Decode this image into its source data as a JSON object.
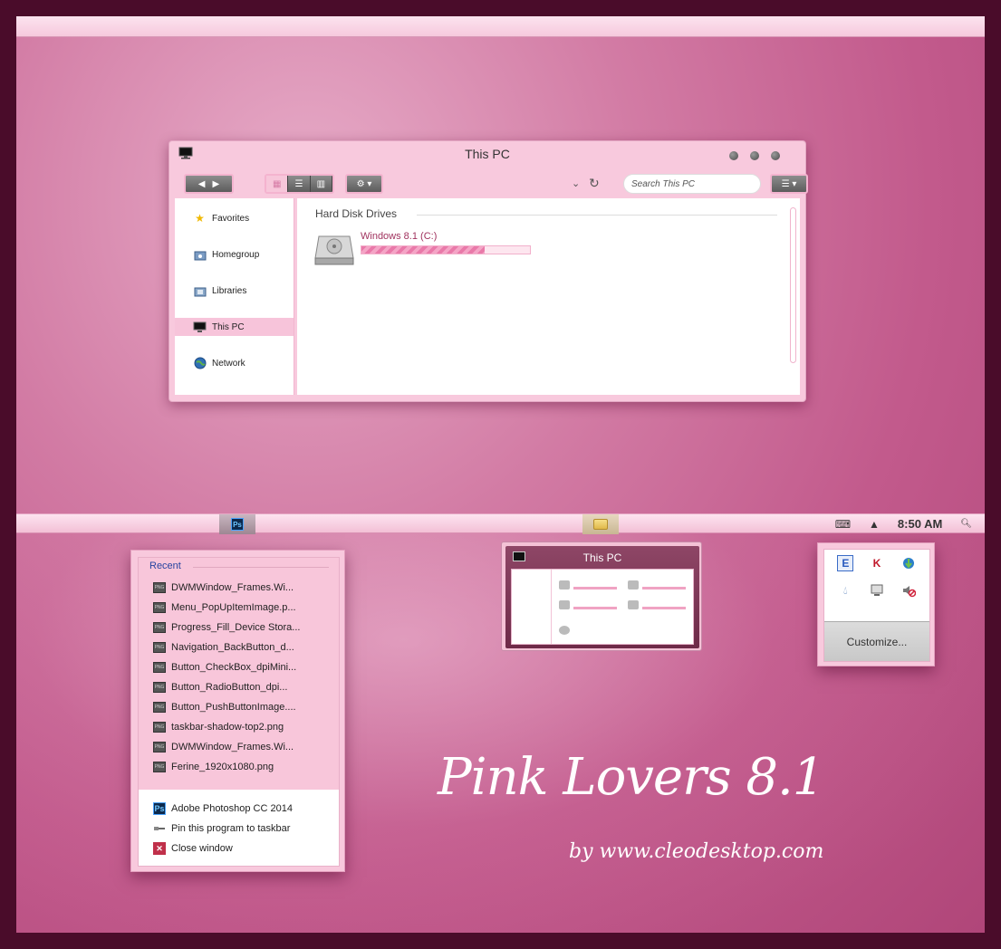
{
  "explorer": {
    "title": "This PC",
    "search_placeholder": "Search This PC",
    "nav_items": [
      {
        "label": "Favorites",
        "icon": "star-icon"
      },
      {
        "label": "Homegroup",
        "icon": "homegroup-icon"
      },
      {
        "label": "Libraries",
        "icon": "libraries-icon"
      },
      {
        "label": "This PC",
        "icon": "computer-icon",
        "selected": true
      },
      {
        "label": "Network",
        "icon": "globe-icon"
      }
    ],
    "section_header": "Hard Disk Drives",
    "drive": {
      "label": "Windows 8.1 (C:)",
      "used_fraction": 0.73
    }
  },
  "taskbar": {
    "clock": "8:50 AM",
    "apps": [
      "photoshop-icon",
      "file-explorer-icon"
    ]
  },
  "jumplist": {
    "recent_header": "Recent",
    "recent_items": [
      "DWMWindow_Frames.Wi...",
      "Menu_PopUpItemImage.p...",
      "Progress_Fill_Device Stora...",
      "Navigation_BackButton_d...",
      "Button_CheckBox_dpiMini...",
      "Button_RadioButton_dpi...",
      "Button_PushButtonImage....",
      "taskbar-shadow-top2.png",
      "DWMWindow_Frames.Wi...",
      "Ferine_1920x1080.png"
    ],
    "tasks": [
      {
        "label": "Adobe Photoshop CC 2014",
        "icon": "photoshop-icon"
      },
      {
        "label": "Pin this program to taskbar",
        "icon": "pin-icon"
      },
      {
        "label": "Close window",
        "icon": "close-icon"
      }
    ]
  },
  "thumbnail": {
    "title": "This PC"
  },
  "tray_flyout": {
    "customize_label": "Customize..."
  },
  "branding": {
    "title": "Pink Lovers 8.1",
    "subtitle": "by www.cleodesktop.com"
  },
  "colors": {
    "accent": "#f8c9dd",
    "frame": "#4a0c2a",
    "drive_label": "#a0325e"
  }
}
